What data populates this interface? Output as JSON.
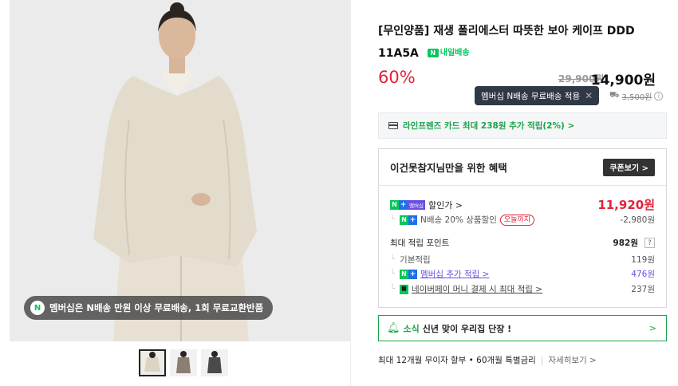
{
  "gallery": {
    "promo_badge": "N",
    "promo_text": "멤버십은 N배송 만원 이상 무료배송, 1회 무료교환반품",
    "thumbnails": [
      "thumb-1",
      "thumb-2",
      "thumb-3"
    ]
  },
  "product": {
    "title": "[무인양품] 재생 폴리에스터 따뜻한 보아 케이프 DDD 11A5A",
    "delivery_badge": "내일배송",
    "discount_rate": "60%",
    "original_price": "29,900원",
    "sale_price": "14,900원",
    "tooltip_text": "멤버십 N배송 무료배송 적용",
    "tooltip_close": "✕",
    "shipping_fee": "3,500원"
  },
  "card_promo": {
    "text": "라인프렌즈 카드 최대 238원 추가 적립(2%) >"
  },
  "benefit": {
    "title": "이건못참지님만을 위한 혜택",
    "coupon_button": "쿠폰보기 >",
    "member_price_label": "할인가 >",
    "member_price": "11,920원",
    "n_delivery_label": "N배송 20% 상품할인",
    "today_tag": "오늘까지",
    "n_delivery_discount": "-2,980원",
    "max_points_label": "최대 적립 포인트",
    "max_points": "982원",
    "help": "?",
    "base_points_label": "기본적립",
    "base_points": "119원",
    "member_points_label": "멤버십 추가 적립 >",
    "member_points": "476원",
    "npay_label": "네이버페이 머니 결제 시 최대 적립 >",
    "npay_points": "237원"
  },
  "news": {
    "tag": "소식",
    "text": "신년 맞이 우리집 단장 !",
    "arrow": ">"
  },
  "installment": {
    "text": "최대 12개월 무이자 할부 • 60개월 특별금리",
    "more": "자세히보기 >"
  },
  "colors": {
    "accent_green": "#03c75a",
    "discount_red": "#e0243a",
    "membership_purple": "#6a4fe0"
  }
}
